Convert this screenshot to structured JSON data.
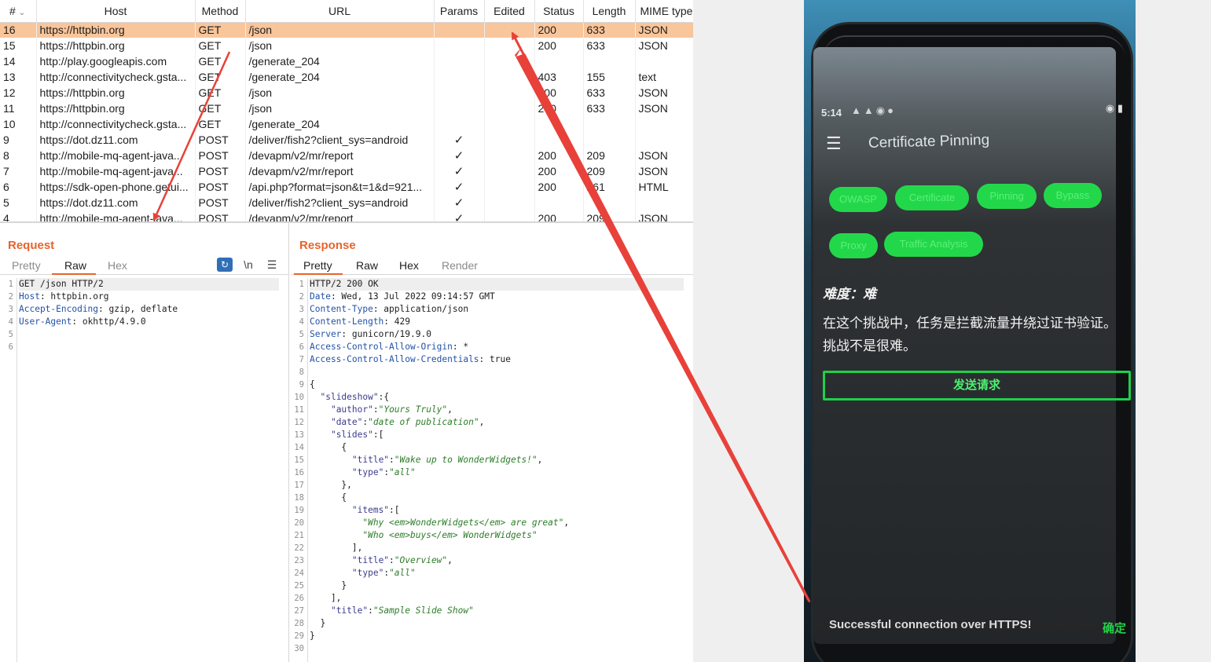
{
  "history": {
    "columns": {
      "num": "#",
      "host": "Host",
      "method": "Method",
      "url": "URL",
      "params": "Params",
      "edited": "Edited",
      "status": "Status",
      "length": "Length",
      "mime": "MIME type"
    },
    "rows": [
      {
        "num": "16",
        "host": "https://httpbin.org",
        "method": "GET",
        "url": "/json",
        "params": "",
        "edited": "",
        "status": "200",
        "length": "633",
        "mime": "JSON",
        "selected": true
      },
      {
        "num": "15",
        "host": "https://httpbin.org",
        "method": "GET",
        "url": "/json",
        "params": "",
        "edited": "",
        "status": "200",
        "length": "633",
        "mime": "JSON"
      },
      {
        "num": "14",
        "host": "http://play.googleapis.com",
        "method": "GET",
        "url": "/generate_204",
        "params": "",
        "edited": "",
        "status": "",
        "length": "",
        "mime": ""
      },
      {
        "num": "13",
        "host": "http://connectivitycheck.gsta...",
        "method": "GET",
        "url": "/generate_204",
        "params": "",
        "edited": "",
        "status": "403",
        "length": "155",
        "mime": "text"
      },
      {
        "num": "12",
        "host": "https://httpbin.org",
        "method": "GET",
        "url": "/json",
        "params": "",
        "edited": "",
        "status": "200",
        "length": "633",
        "mime": "JSON"
      },
      {
        "num": "11",
        "host": "https://httpbin.org",
        "method": "GET",
        "url": "/json",
        "params": "",
        "edited": "",
        "status": "200",
        "length": "633",
        "mime": "JSON"
      },
      {
        "num": "10",
        "host": "http://connectivitycheck.gsta...",
        "method": "GET",
        "url": "/generate_204",
        "params": "",
        "edited": "",
        "status": "",
        "length": "",
        "mime": ""
      },
      {
        "num": "9",
        "host": "https://dot.dz11.com",
        "method": "POST",
        "url": "/deliver/fish2?client_sys=android",
        "params": "✓",
        "edited": "",
        "status": "",
        "length": "",
        "mime": ""
      },
      {
        "num": "8",
        "host": "http://mobile-mq-agent-java...",
        "method": "POST",
        "url": "/devapm/v2/mr/report",
        "params": "✓",
        "edited": "",
        "status": "200",
        "length": "209",
        "mime": "JSON"
      },
      {
        "num": "7",
        "host": "http://mobile-mq-agent-java...",
        "method": "POST",
        "url": "/devapm/v2/mr/report",
        "params": "✓",
        "edited": "",
        "status": "200",
        "length": "209",
        "mime": "JSON"
      },
      {
        "num": "6",
        "host": "https://sdk-open-phone.getui...",
        "method": "POST",
        "url": "/api.php?format=json&t=1&d=921...",
        "params": "✓",
        "edited": "",
        "status": "200",
        "length": "261",
        "mime": "HTML"
      },
      {
        "num": "5",
        "host": "https://dot.dz11.com",
        "method": "POST",
        "url": "/deliver/fish2?client_sys=android",
        "params": "✓",
        "edited": "",
        "status": "",
        "length": "",
        "mime": ""
      },
      {
        "num": "4",
        "host": "http://mobile-mq-agent-java...",
        "method": "POST",
        "url": "/devapm/v2/mr/report",
        "params": "✓",
        "edited": "",
        "status": "200",
        "length": "209",
        "mime": "JSON"
      }
    ]
  },
  "request": {
    "title": "Request",
    "tabs": [
      "Pretty",
      "Raw",
      "Hex"
    ],
    "active_tab": "Raw",
    "newline_toggle": "\\n",
    "lines": [
      {
        "n": "1",
        "name": "",
        "value": "GET /json HTTP/2"
      },
      {
        "n": "2",
        "name": "Host",
        "value": ": httpbin.org"
      },
      {
        "n": "3",
        "name": "Accept-Encoding",
        "value": ": gzip, deflate"
      },
      {
        "n": "4",
        "name": "User-Agent",
        "value": ": okhttp/4.9.0"
      },
      {
        "n": "5",
        "name": "",
        "value": ""
      },
      {
        "n": "6",
        "name": "",
        "value": ""
      }
    ]
  },
  "response": {
    "title": "Response",
    "tabs": [
      "Pretty",
      "Raw",
      "Hex",
      "Render"
    ],
    "active_tab": "Pretty",
    "lines": [
      {
        "n": "1",
        "kind": "plain",
        "text": "HTTP/2 200 OK"
      },
      {
        "n": "2",
        "kind": "header",
        "name": "Date",
        "text": ": Wed, 13 Jul 2022 09:14:57 GMT"
      },
      {
        "n": "3",
        "kind": "header",
        "name": "Content-Type",
        "text": ": application/json"
      },
      {
        "n": "4",
        "kind": "header",
        "name": "Content-Length",
        "text": ": 429"
      },
      {
        "n": "5",
        "kind": "header",
        "name": "Server",
        "text": ": gunicorn/19.9.0"
      },
      {
        "n": "6",
        "kind": "header",
        "name": "Access-Control-Allow-Origin",
        "text": ": *"
      },
      {
        "n": "7",
        "kind": "header",
        "name": "Access-Control-Allow-Credentials",
        "text": ": true"
      },
      {
        "n": "8",
        "kind": "plain",
        "text": ""
      },
      {
        "n": "9",
        "kind": "plain",
        "text": "{"
      },
      {
        "n": "10",
        "kind": "json",
        "indent": "  ",
        "key": "\"slideshow\"",
        "sep": ":{",
        "str": "",
        "tail": ""
      },
      {
        "n": "11",
        "kind": "json",
        "indent": "    ",
        "key": "\"author\"",
        "sep": ":",
        "str": "\"Yours Truly\"",
        "tail": ","
      },
      {
        "n": "12",
        "kind": "json",
        "indent": "    ",
        "key": "\"date\"",
        "sep": ":",
        "str": "\"date of publication\"",
        "tail": ","
      },
      {
        "n": "13",
        "kind": "json",
        "indent": "    ",
        "key": "\"slides\"",
        "sep": ":[",
        "str": "",
        "tail": ""
      },
      {
        "n": "14",
        "kind": "plain",
        "text": "      {"
      },
      {
        "n": "15",
        "kind": "json",
        "indent": "        ",
        "key": "\"title\"",
        "sep": ":",
        "str": "\"Wake up to WonderWidgets!\"",
        "tail": ","
      },
      {
        "n": "16",
        "kind": "json",
        "indent": "        ",
        "key": "\"type\"",
        "sep": ":",
        "str": "\"all\"",
        "tail": ""
      },
      {
        "n": "17",
        "kind": "plain",
        "text": "      },"
      },
      {
        "n": "18",
        "kind": "plain",
        "text": "      {"
      },
      {
        "n": "19",
        "kind": "json",
        "indent": "        ",
        "key": "\"items\"",
        "sep": ":[",
        "str": "",
        "tail": ""
      },
      {
        "n": "20",
        "kind": "json",
        "indent": "          ",
        "key": "",
        "sep": "",
        "str": "\"Why <em>WonderWidgets</em> are great\"",
        "tail": ","
      },
      {
        "n": "21",
        "kind": "json",
        "indent": "          ",
        "key": "",
        "sep": "",
        "str": "\"Who <em>buys</em> WonderWidgets\"",
        "tail": ""
      },
      {
        "n": "22",
        "kind": "plain",
        "text": "        ],"
      },
      {
        "n": "23",
        "kind": "json",
        "indent": "        ",
        "key": "\"title\"",
        "sep": ":",
        "str": "\"Overview\"",
        "tail": ","
      },
      {
        "n": "24",
        "kind": "json",
        "indent": "        ",
        "key": "\"type\"",
        "sep": ":",
        "str": "\"all\"",
        "tail": ""
      },
      {
        "n": "25",
        "kind": "plain",
        "text": "      }"
      },
      {
        "n": "26",
        "kind": "plain",
        "text": "    ],"
      },
      {
        "n": "27",
        "kind": "json",
        "indent": "    ",
        "key": "\"title\"",
        "sep": ":",
        "str": "\"Sample Slide Show\"",
        "tail": ""
      },
      {
        "n": "28",
        "kind": "plain",
        "text": "  }"
      },
      {
        "n": "29",
        "kind": "plain",
        "text": "}"
      },
      {
        "n": "30",
        "kind": "plain",
        "text": ""
      }
    ]
  },
  "phone": {
    "status_time": "5:14",
    "app_title": "Certificate Pinning",
    "tags_row1": [
      "OWASP",
      "Certificate",
      "Pinning",
      "Bypass"
    ],
    "tags_row2": [
      "Proxy",
      "Traffic Analysis"
    ],
    "difficulty": "难度：难",
    "description": "在这个挑战中，任务是拦截流量并绕过证书验证。挑战不是很难。",
    "send_button": "发送请求",
    "toast": "Successful connection over HTTPS!",
    "toast_action": "确定"
  },
  "colors": {
    "accent": "#e8642b",
    "selected_row": "#f9c59a",
    "arrow": "#e8413a",
    "phone_green": "#22d84a"
  },
  "icons": {
    "sort": "chevron-down-icon",
    "wrap": "word-wrap-icon",
    "menu": "hamburger-menu-icon"
  }
}
